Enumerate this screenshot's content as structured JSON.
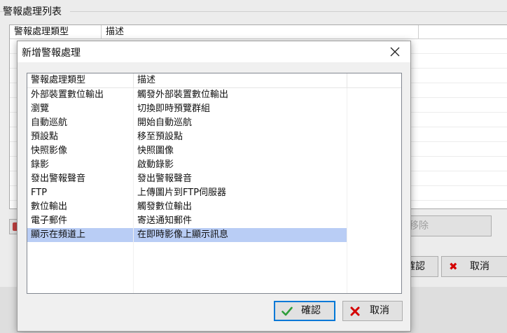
{
  "background": {
    "group_title": "警報處理列表",
    "table_headers": [
      "警報處理類型",
      "描述"
    ],
    "remove_button": "移除",
    "ok_button": "確認",
    "cancel_button": "取消"
  },
  "dialog": {
    "title": "新增警報處理",
    "headers": [
      "警報處理類型",
      "描述"
    ],
    "rows": [
      {
        "type": "外部裝置數位輸出",
        "desc": "觸發外部裝置數位輸出"
      },
      {
        "type": "瀏覽",
        "desc": "切換即時預覽群組"
      },
      {
        "type": "自動巡航",
        "desc": "開始自動巡航"
      },
      {
        "type": "預設點",
        "desc": "移至預設點"
      },
      {
        "type": "快照影像",
        "desc": "快照圖像"
      },
      {
        "type": "錄影",
        "desc": "啟動錄影"
      },
      {
        "type": "發出警報聲音",
        "desc": "發出警報聲音"
      },
      {
        "type": "FTP",
        "desc": "上傳圖片到FTP伺服器"
      },
      {
        "type": "數位輸出",
        "desc": "觸發數位輸出"
      },
      {
        "type": "電子郵件",
        "desc": "寄送通知郵件"
      },
      {
        "type": "顯示在頻道上",
        "desc": "在即時影像上顯示訊息"
      }
    ],
    "selected_index": 10,
    "ok_button": "確認",
    "cancel_button": "取消"
  },
  "colors": {
    "selection": "#b9cdf5",
    "ok_icon": "#2e9e3a",
    "cancel_icon": "#d40000"
  },
  "icons": [
    "close-icon",
    "check-icon",
    "x-icon"
  ]
}
